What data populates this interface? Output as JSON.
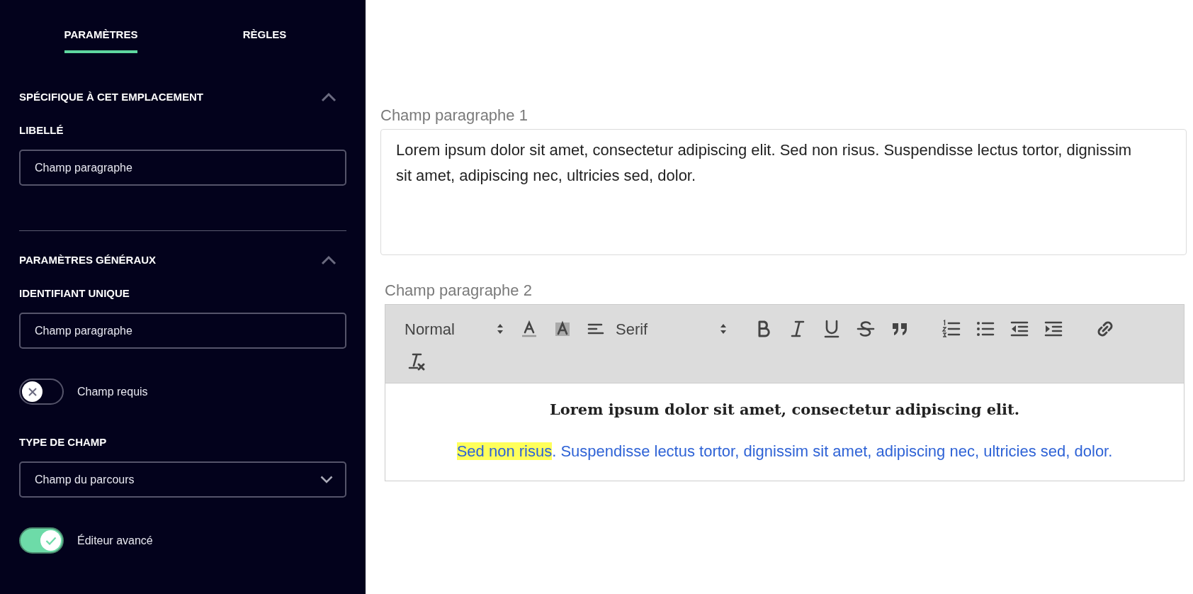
{
  "tabs": [
    {
      "label": "PARAMÈTRES",
      "selected": true
    },
    {
      "label": "RÈGLES",
      "selected": false
    }
  ],
  "sections": [
    {
      "title": "SPÉCIFIQUE À CET EMPLACEMENT",
      "expanded": true,
      "fields": [
        {
          "kind": "text",
          "label": "LIBELLÉ",
          "value": "Champ paragraphe"
        }
      ]
    },
    {
      "title": "PARAMÈTRES GÉNÉRAUX",
      "expanded": true,
      "fields": [
        {
          "kind": "text",
          "label": "IDENTIFIANT UNIQUE",
          "value": "Champ paragraphe"
        },
        {
          "kind": "toggle",
          "label": "Champ requis",
          "on": false
        },
        {
          "kind": "select",
          "label": "TYPE DE CHAMP",
          "value": "Champ du parcours"
        },
        {
          "kind": "toggle",
          "label": "Éditeur avancé",
          "on": true
        }
      ]
    }
  ],
  "preview": {
    "field_1": {
      "label": "Champ paragraphe 1",
      "value": "Lorem ipsum dolor sit amet, consectetur adipiscing elit. Sed non risus. Suspendisse lectus tortor, dignissim sit amet, adipiscing nec, ultricies sed, dolor."
    },
    "field_2": {
      "label": "Champ paragraphe 2",
      "toolbar": {
        "header_select": "Normal",
        "font_select": "Serif"
      },
      "paragraphs": [
        {
          "kind": "heading",
          "segments": [
            {
              "text": "Lorem ipsum dolor sit amet, consectetur adipiscing elit.",
              "highlighted": false
            }
          ]
        },
        {
          "kind": "colored",
          "color": "#2f63d6",
          "segments": [
            {
              "text": "Sed non risus",
              "highlighted": true
            },
            {
              "text": ". Suspendisse lectus tortor, dignissim sit amet, adipiscing nec, ultricies sed, dolor.",
              "highlighted": false
            }
          ]
        }
      ]
    }
  }
}
